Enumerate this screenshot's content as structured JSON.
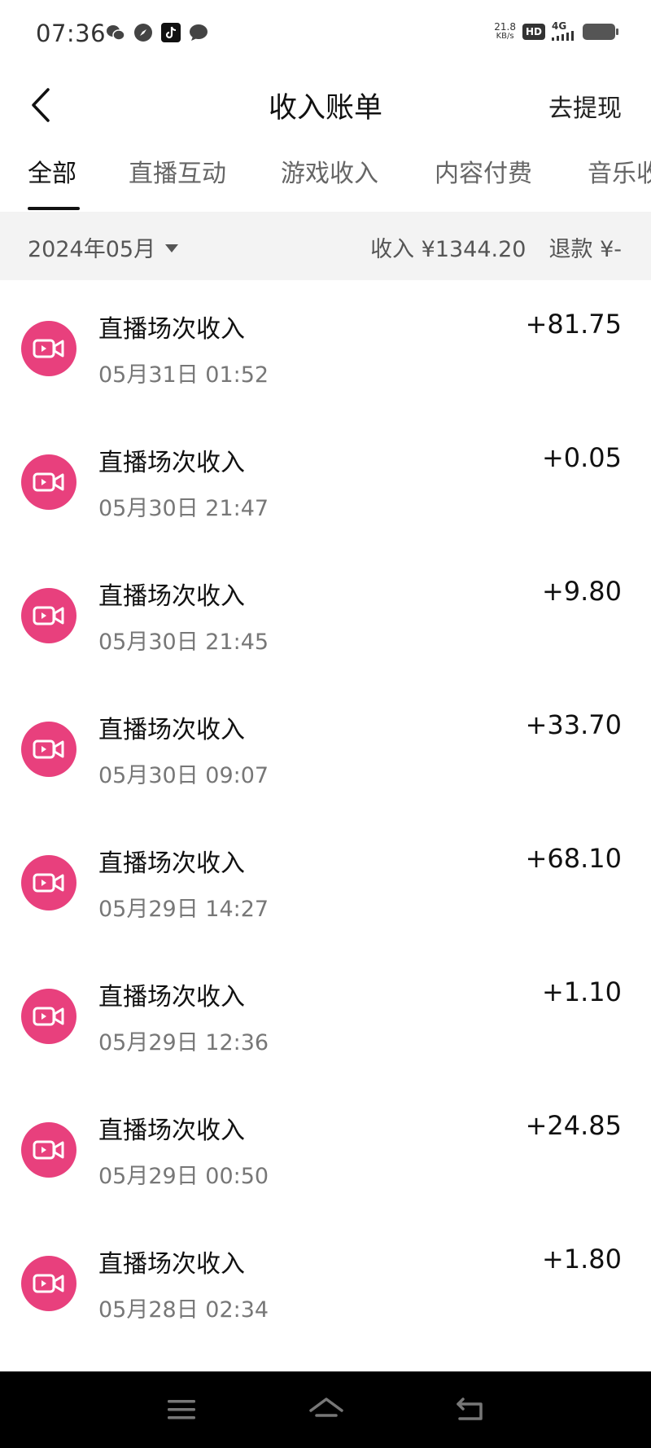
{
  "status_bar": {
    "time": "07:36",
    "left_icons": [
      "wechat-icon",
      "compass-icon",
      "tiktok-icon",
      "message-icon"
    ],
    "net_speed_value": "21.8",
    "net_speed_unit": "KB/s",
    "hd_label": "HD",
    "network_label": "4G"
  },
  "header": {
    "title": "收入账单",
    "action_label": "去提现",
    "back_icon": "chevron-left-icon"
  },
  "tabs": [
    {
      "label": "全部",
      "active": true
    },
    {
      "label": "直播互动",
      "active": false
    },
    {
      "label": "游戏收入",
      "active": false
    },
    {
      "label": "内容付费",
      "active": false
    },
    {
      "label": "音乐收",
      "active": false
    }
  ],
  "filter": {
    "month": "2024年05月",
    "income_summary": "收入 ¥1344.20",
    "refund_summary": "退款 ¥-"
  },
  "records": [
    {
      "title": "直播场次收入",
      "time": "05月31日 01:52",
      "amount": "+81.75"
    },
    {
      "title": "直播场次收入",
      "time": "05月30日 21:47",
      "amount": "+0.05"
    },
    {
      "title": "直播场次收入",
      "time": "05月30日 21:45",
      "amount": "+9.80"
    },
    {
      "title": "直播场次收入",
      "time": "05月30日 09:07",
      "amount": "+33.70"
    },
    {
      "title": "直播场次收入",
      "time": "05月29日 14:27",
      "amount": "+68.10"
    },
    {
      "title": "直播场次收入",
      "time": "05月29日 12:36",
      "amount": "+1.10"
    },
    {
      "title": "直播场次收入",
      "time": "05月29日 00:50",
      "amount": "+24.85"
    },
    {
      "title": "直播场次收入",
      "time": "05月28日 02:34",
      "amount": "+1.80"
    }
  ],
  "colors": {
    "accent_pink": "#e8407d",
    "filter_bg": "#f3f3f3",
    "nav_bg": "#000000"
  },
  "nav_bar": {
    "icons": [
      "menu-icon",
      "home-icon",
      "back-icon"
    ]
  }
}
